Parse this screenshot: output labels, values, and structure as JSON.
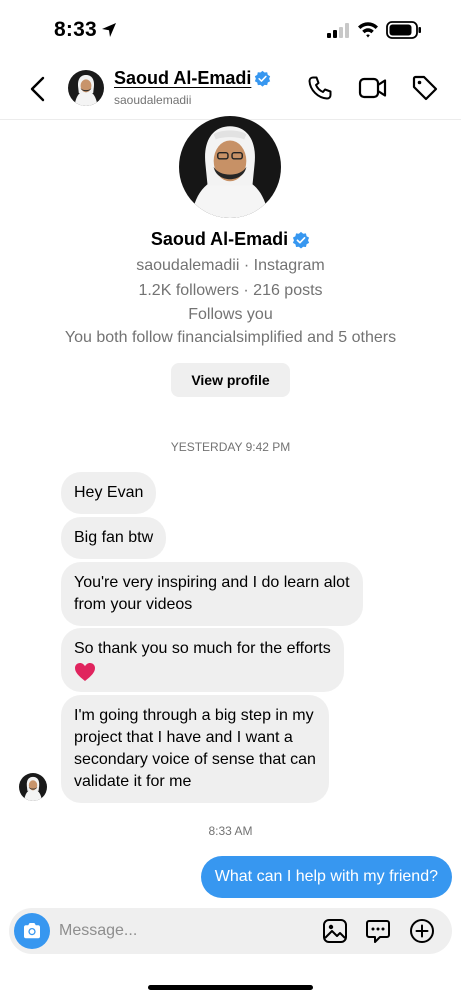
{
  "status_bar": {
    "time": "8:33",
    "icons": [
      "location-arrow-icon",
      "cellular-signal-icon",
      "wifi-icon",
      "battery-icon"
    ]
  },
  "header": {
    "name": "Saoud Al-Emadi",
    "handle": "saoudalemadii",
    "icons": [
      "back-chevron-icon",
      "verified-badge-icon",
      "phone-icon",
      "video-camera-icon",
      "tag-icon"
    ]
  },
  "profile": {
    "name": "Saoud Al-Emadi",
    "handle_line": "saoudalemadii · Instagram",
    "stats": "1.2K followers · 216 posts",
    "follows": "Follows you",
    "mutual": "You both follow financialsimplified and 5 others",
    "view_profile_label": "View profile"
  },
  "conversation": {
    "timestamp_1": "YESTERDAY 9:42 PM",
    "incoming": [
      {
        "lines": [
          "Hey Evan"
        ]
      },
      {
        "lines": [
          "Big fan btw"
        ]
      },
      {
        "lines": [
          "You're very inspiring and I do learn alot",
          "from your videos"
        ]
      },
      {
        "lines": [
          "So thank you so much for the efforts"
        ],
        "emoji": "heart-icon"
      },
      {
        "lines": [
          "I'm going through a big step in my",
          "project that I have and I want a",
          "secondary voice of sense that can",
          "validate it for me"
        ]
      }
    ],
    "timestamp_2": "8:33 AM",
    "outgoing": [
      {
        "text": "What can I help with my friend?"
      }
    ]
  },
  "composer": {
    "placeholder": "Message...",
    "icons": [
      "camera-icon",
      "gallery-icon",
      "sticker-icon",
      "plus-icon"
    ]
  },
  "colors": {
    "accent_blue": "#3797f0",
    "bubble_gray": "#efefef",
    "secondary_text": "#737373",
    "heart_red": "#e0245e"
  }
}
